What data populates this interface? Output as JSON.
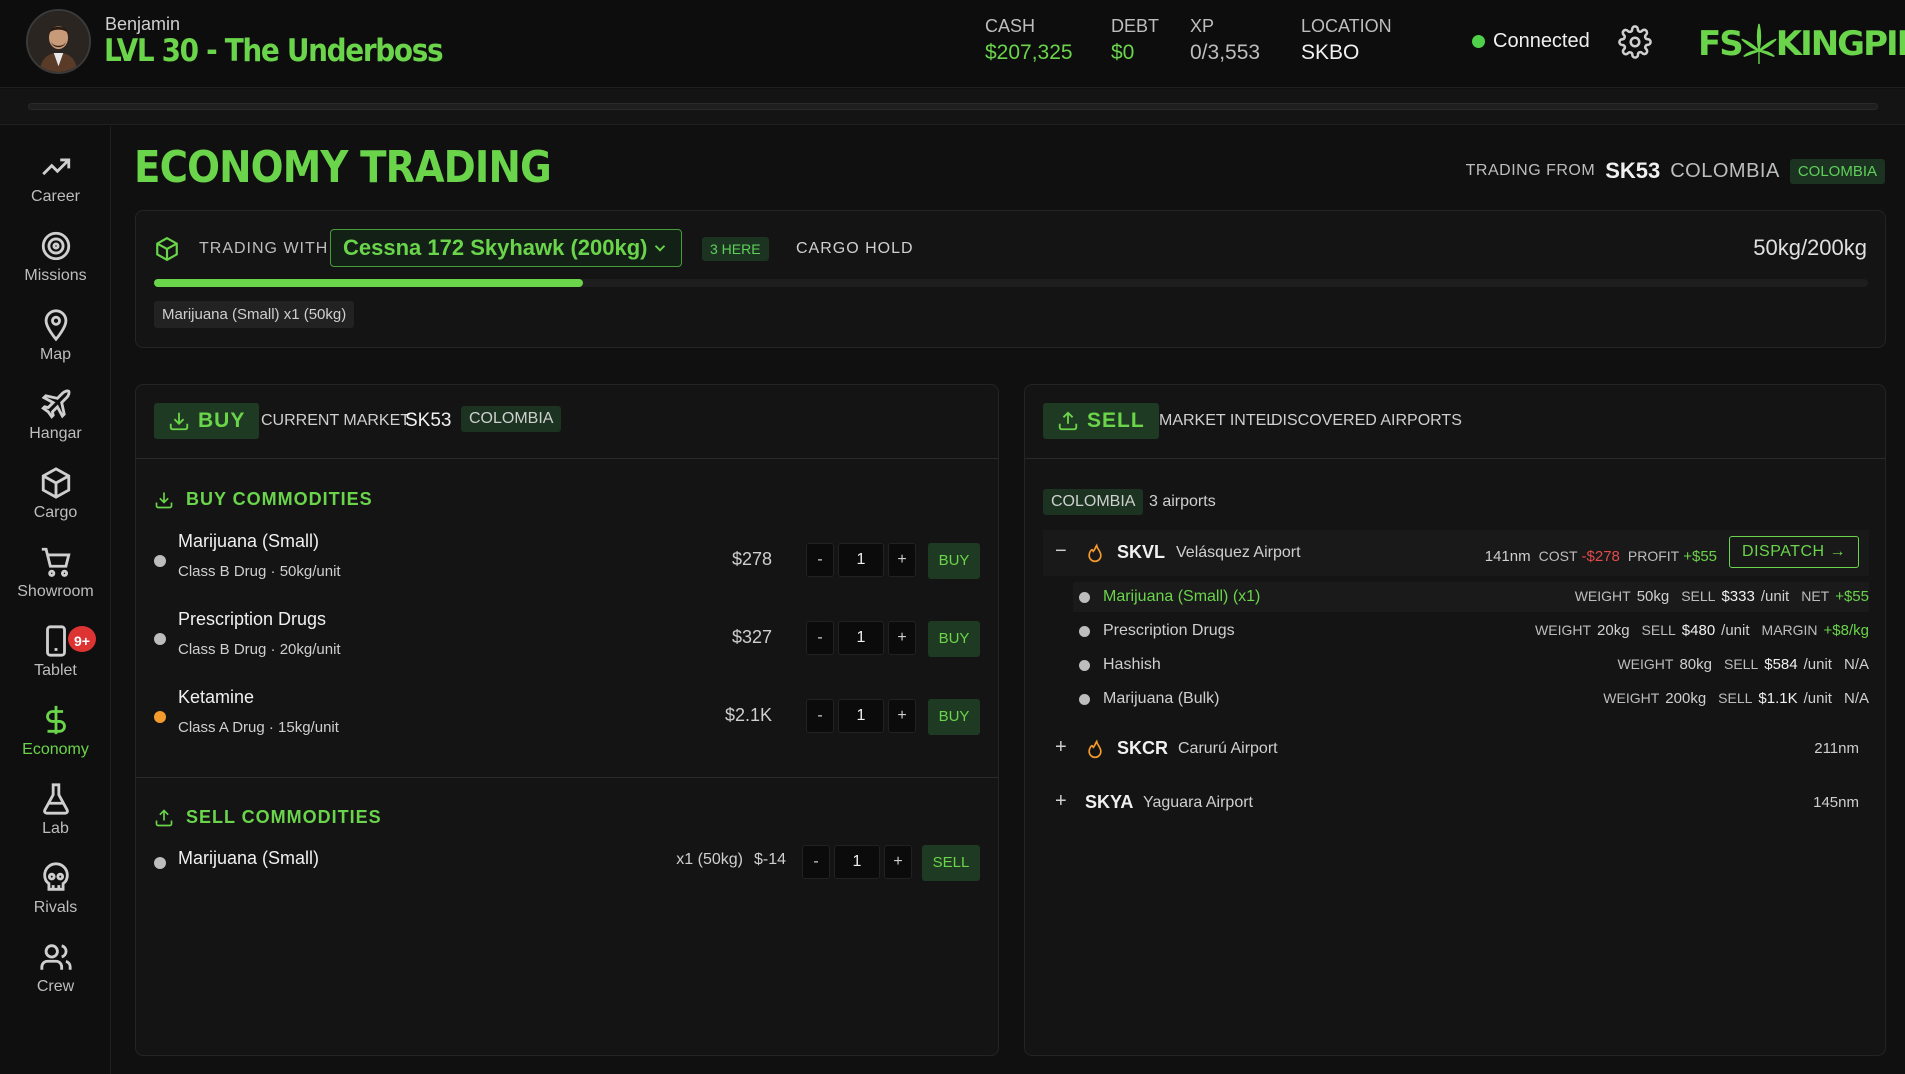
{
  "header": {
    "player_name": "Benjamin",
    "level_title": "LVL 30 - The Underboss",
    "stats": [
      {
        "label": "CASH",
        "value": "$207,325",
        "color": "#6ad44a"
      },
      {
        "label": "DEBT",
        "value": "$0",
        "color": "#6ad44a"
      },
      {
        "label": "XP",
        "value": "0/3,553",
        "color": "#bdbdbd"
      },
      {
        "label": "LOCATION",
        "value": "SKBO",
        "color": "#f0f0f0"
      }
    ],
    "connection": "Connected",
    "logo_left": "FS",
    "logo_right": "KINGPIN"
  },
  "sidebar": {
    "items": [
      {
        "label": "Career",
        "icon": "trending-up-icon"
      },
      {
        "label": "Missions",
        "icon": "target-icon"
      },
      {
        "label": "Map",
        "icon": "map-pin-icon"
      },
      {
        "label": "Hangar",
        "icon": "plane-icon"
      },
      {
        "label": "Cargo",
        "icon": "box-icon"
      },
      {
        "label": "Showroom",
        "icon": "cart-icon"
      },
      {
        "label": "Tablet",
        "icon": "tablet-icon",
        "badge": "9+"
      },
      {
        "label": "Economy",
        "icon": "dollar-icon",
        "active": true
      },
      {
        "label": "Lab",
        "icon": "flask-icon"
      },
      {
        "label": "Rivals",
        "icon": "skull-icon"
      },
      {
        "label": "Crew",
        "icon": "users-icon"
      }
    ]
  },
  "page": {
    "title": "ECONOMY TRADING",
    "trading_from_label": "TRADING FROM",
    "trading_from_code": "SK53",
    "trading_from_country": "COLOMBIA",
    "trading_from_chip": "COLOMBIA"
  },
  "cargo": {
    "trading_with_label": "TRADING WITH",
    "aircraft": "Cessna 172 Skyhawk (200kg)",
    "here_chip": "3 HERE",
    "hold_label": "CARGO HOLD",
    "weight": "50kg/200kg",
    "fill_fraction": 0.25,
    "tag": "Marijuana (Small) x1 (50kg)"
  },
  "buy_panel": {
    "button": "BUY",
    "market_label": "CURRENT MARKET",
    "market_code": "SK53",
    "market_chip": "COLOMBIA",
    "buy_title": "BUY COMMODITIES",
    "buy_items": [
      {
        "name": "Marijuana (Small)",
        "sub": "Class B Drug · 50kg/unit",
        "price": "$278",
        "qty": "1",
        "action": "BUY",
        "dot": "#bdbdbd"
      },
      {
        "name": "Prescription Drugs",
        "sub": "Class B Drug · 20kg/unit",
        "price": "$327",
        "qty": "1",
        "action": "BUY",
        "dot": "#bdbdbd"
      },
      {
        "name": "Ketamine",
        "sub": "Class A Drug · 15kg/unit",
        "price": "$2.1K",
        "qty": "1",
        "action": "BUY",
        "dot": "#f59a2c"
      }
    ],
    "sell_title": "SELL COMMODITIES",
    "sell_items": [
      {
        "name": "Marijuana (Small)",
        "held": "x1 (50kg)",
        "delta": "$-14",
        "qty": "1",
        "action": "SELL"
      }
    ],
    "minus": "-",
    "plus": "+"
  },
  "sell_panel": {
    "button": "SELL",
    "market_intel": "MARKET INTEL",
    "discovered": "DISCOVERED AIRPORTS",
    "country_chip": "COLOMBIA",
    "airport_count": "3 airports",
    "airports": [
      {
        "toggle": "−",
        "code": "SKVL",
        "name": "Velásquez Airport",
        "distance": "141nm",
        "cost_label": "COST",
        "cost": "-$278",
        "profit_label": "PROFIT",
        "profit": "+$55",
        "dispatch": "DISPATCH →",
        "intel": [
          {
            "name": "Marijuana (Small) (x1)",
            "weight_label": "WEIGHT",
            "weight": "50kg",
            "sell_label": "SELL",
            "sell": "$333",
            "unit": "/unit",
            "tail_label": "NET",
            "tail": "+$55"
          },
          {
            "name": "Prescription Drugs",
            "weight_label": "WEIGHT",
            "weight": "20kg",
            "sell_label": "SELL",
            "sell": "$480",
            "unit": "/unit",
            "tail_label": "MARGIN",
            "tail": "+$8/kg"
          },
          {
            "name": "Hashish",
            "weight_label": "WEIGHT",
            "weight": "80kg",
            "sell_label": "SELL",
            "sell": "$584",
            "unit": "/unit",
            "tail_label": "",
            "tail": "N/A"
          },
          {
            "name": "Marijuana (Bulk)",
            "weight_label": "WEIGHT",
            "weight": "200kg",
            "sell_label": "SELL",
            "sell": "$1.1K",
            "unit": "/unit",
            "tail_label": "",
            "tail": "N/A"
          }
        ]
      },
      {
        "toggle": "+",
        "code": "SKCR",
        "name": "Carurú Airport",
        "distance": "211nm"
      },
      {
        "toggle": "+",
        "code": "SKYA",
        "name": "Yaguara Airport",
        "distance": "145nm"
      }
    ]
  },
  "colors": {
    "accent": "#6ad44a",
    "negative": "#e14b4b",
    "warning": "#f59a2c",
    "background": "#101010"
  }
}
